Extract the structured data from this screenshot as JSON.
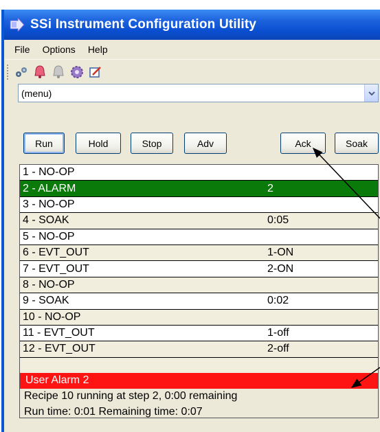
{
  "window": {
    "title": "SSi Instrument Configuration Utility"
  },
  "menu": {
    "file": "File",
    "options": "Options",
    "help": "Help"
  },
  "combo": {
    "value": "(menu)"
  },
  "buttons": {
    "run": "Run",
    "hold": "Hold",
    "stop": "Stop",
    "adv": "Adv",
    "ack": "Ack",
    "soak": "Soak"
  },
  "steps": [
    {
      "step": "1 - NO-OP",
      "value": ""
    },
    {
      "step": "2 - ALARM",
      "value": "2"
    },
    {
      "step": "3 - NO-OP",
      "value": ""
    },
    {
      "step": "4 - SOAK",
      "value": "0:05"
    },
    {
      "step": "5 - NO-OP",
      "value": ""
    },
    {
      "step": "6 - EVT_OUT",
      "value": "1-ON"
    },
    {
      "step": "7 - EVT_OUT",
      "value": "2-ON"
    },
    {
      "step": "8 - NO-OP",
      "value": ""
    },
    {
      "step": "9 - SOAK",
      "value": "0:02"
    },
    {
      "step": "10 - NO-OP",
      "value": ""
    },
    {
      "step": "11 - EVT_OUT",
      "value": "1-off"
    },
    {
      "step": "12 - EVT_OUT",
      "value": "2-off"
    }
  ],
  "alarm": {
    "text": "User Alarm 2",
    "color": "#ff1414"
  },
  "status": {
    "line1": "Recipe 10 running at step 2, 0:00 remaining",
    "line2": "Run time: 0:01 Remaining time: 0:07"
  },
  "colors": {
    "selected": "#0a7a0a",
    "title_bar": "#0a4fd0"
  }
}
